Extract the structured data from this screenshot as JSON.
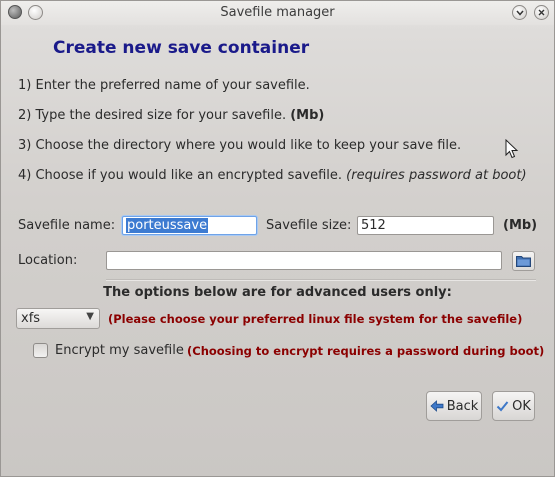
{
  "window": {
    "title": "Savefile manager"
  },
  "heading": "Create new save container",
  "steps": {
    "s1": "1) Enter the preferred name of your savefile.",
    "s2_text": "2) Type the desired size for your savefile. ",
    "s2_bold": "(Mb)",
    "s3": "3) Choose the directory where you would like to keep your save file.",
    "s4_text": "4) Choose if you would like an encrypted savefile. ",
    "s4_italic": "(requires password at boot)"
  },
  "form": {
    "name_label": "Savefile name:",
    "name_value": "porteussave",
    "size_label": "Savefile size:",
    "size_value": "512",
    "size_unit": "(Mb)",
    "location_label": "Location:",
    "location_value": ""
  },
  "advanced": {
    "note": "The options below are for advanced users only:",
    "fs_selected": "xfs",
    "fs_hint": "(Please choose your preferred linux file system for the savefile)",
    "encrypt_label": "Encrypt my savefile",
    "encrypt_checked": false,
    "encrypt_hint": "(Choosing to encrypt requires a password during boot)"
  },
  "buttons": {
    "back": "Back",
    "ok": "OK"
  },
  "icons": {
    "app": "app-icon",
    "minimize": "chevron-down-icon",
    "close": "close-icon",
    "folder": "folder-icon",
    "back": "arrow-left-icon",
    "ok": "checkmark-icon"
  },
  "colors": {
    "heading": "#1a1a8a",
    "hint": "#8b0000",
    "selection": "#3d7bd1"
  }
}
